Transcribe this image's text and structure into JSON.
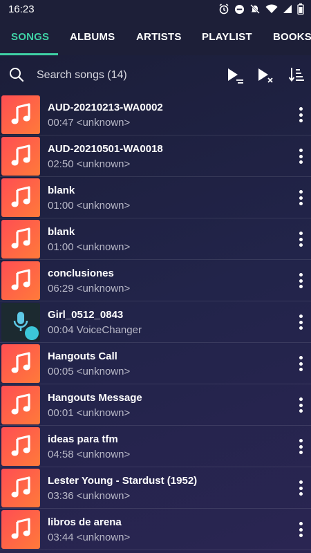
{
  "status_bar": {
    "time": "16:23",
    "icons": [
      "alarm-icon",
      "dnd-icon",
      "mute-icon",
      "wifi-icon",
      "signal-icon",
      "battery-icon"
    ]
  },
  "tabs": [
    {
      "label": "SONGS",
      "active": true
    },
    {
      "label": "ALBUMS",
      "active": false
    },
    {
      "label": "ARTISTS",
      "active": false
    },
    {
      "label": "PLAYLIST",
      "active": false
    },
    {
      "label": "BOOKS",
      "active": false
    }
  ],
  "search": {
    "placeholder": "Search songs (14)",
    "icons": [
      "play-queue-icon",
      "shuffle-play-icon",
      "sort-icon"
    ]
  },
  "accent_color": "#3fd1a5",
  "songs": [
    {
      "title": "AUD-20210213-WA0002",
      "subtitle": "00:47 <unknown>",
      "thumb": "music-note-icon"
    },
    {
      "title": "AUD-20210501-WA0018",
      "subtitle": "02:50 <unknown>",
      "thumb": "music-note-icon"
    },
    {
      "title": "blank",
      "subtitle": "01:00 <unknown>",
      "thumb": "music-note-icon"
    },
    {
      "title": "blank",
      "subtitle": "01:00 <unknown>",
      "thumb": "music-note-icon"
    },
    {
      "title": "conclusiones",
      "subtitle": "06:29 <unknown>",
      "thumb": "music-note-icon"
    },
    {
      "title": "Girl_0512_0843",
      "subtitle": "00:04 VoiceChanger",
      "thumb": "microphone-icon"
    },
    {
      "title": "Hangouts Call",
      "subtitle": "00:05 <unknown>",
      "thumb": "music-note-icon"
    },
    {
      "title": "Hangouts Message",
      "subtitle": "00:01 <unknown>",
      "thumb": "music-note-icon"
    },
    {
      "title": "ideas para tfm",
      "subtitle": "04:58 <unknown>",
      "thumb": "music-note-icon"
    },
    {
      "title": "Lester Young - Stardust (1952)",
      "subtitle": "03:36 <unknown>",
      "thumb": "music-note-icon"
    },
    {
      "title": "libros de arena",
      "subtitle": "03:44 <unknown>",
      "thumb": "music-note-icon"
    }
  ]
}
